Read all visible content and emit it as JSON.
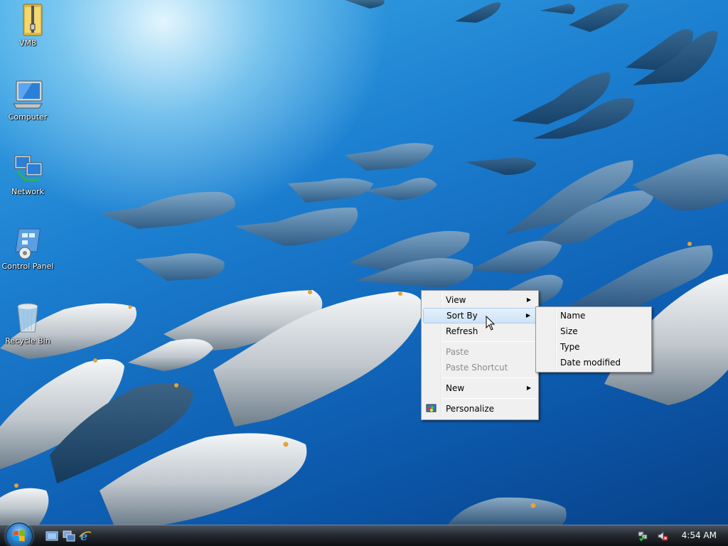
{
  "desktop": {
    "icons": [
      {
        "label": "VM8",
        "icon": "folder-zip-icon"
      },
      {
        "label": "Computer",
        "icon": "computer-icon"
      },
      {
        "label": "Network",
        "icon": "network-icon"
      },
      {
        "label": "Control Panel",
        "icon": "control-panel-icon"
      },
      {
        "label": "Recycle Bin",
        "icon": "recycle-bin-icon"
      }
    ]
  },
  "context_menu": {
    "items": [
      {
        "label": "View",
        "submenu": true,
        "enabled": true
      },
      {
        "label": "Sort By",
        "submenu": true,
        "enabled": true,
        "highlighted": true
      },
      {
        "label": "Refresh",
        "enabled": true
      },
      {
        "label": "Paste",
        "enabled": false
      },
      {
        "label": "Paste Shortcut",
        "enabled": false
      },
      {
        "label": "New",
        "submenu": true,
        "enabled": true
      },
      {
        "label": "Personalize",
        "enabled": true,
        "icon": "personalize-icon"
      }
    ]
  },
  "sort_submenu": {
    "items": [
      {
        "label": "Name"
      },
      {
        "label": "Size"
      },
      {
        "label": "Type"
      },
      {
        "label": "Date modified"
      }
    ]
  },
  "taskbar": {
    "quick_launch": [
      "show-desktop-icon",
      "switch-windows-icon",
      "internet-explorer-icon"
    ],
    "tray_icons": [
      "network-status-icon",
      "volume-muted-icon"
    ],
    "clock": "4:54 AM"
  },
  "colors": {
    "menu_bg": "#f0f0f0",
    "menu_highlight": "#cde3f7",
    "disabled_text": "#8d8d8d",
    "taskbar": "#1a1e23"
  }
}
